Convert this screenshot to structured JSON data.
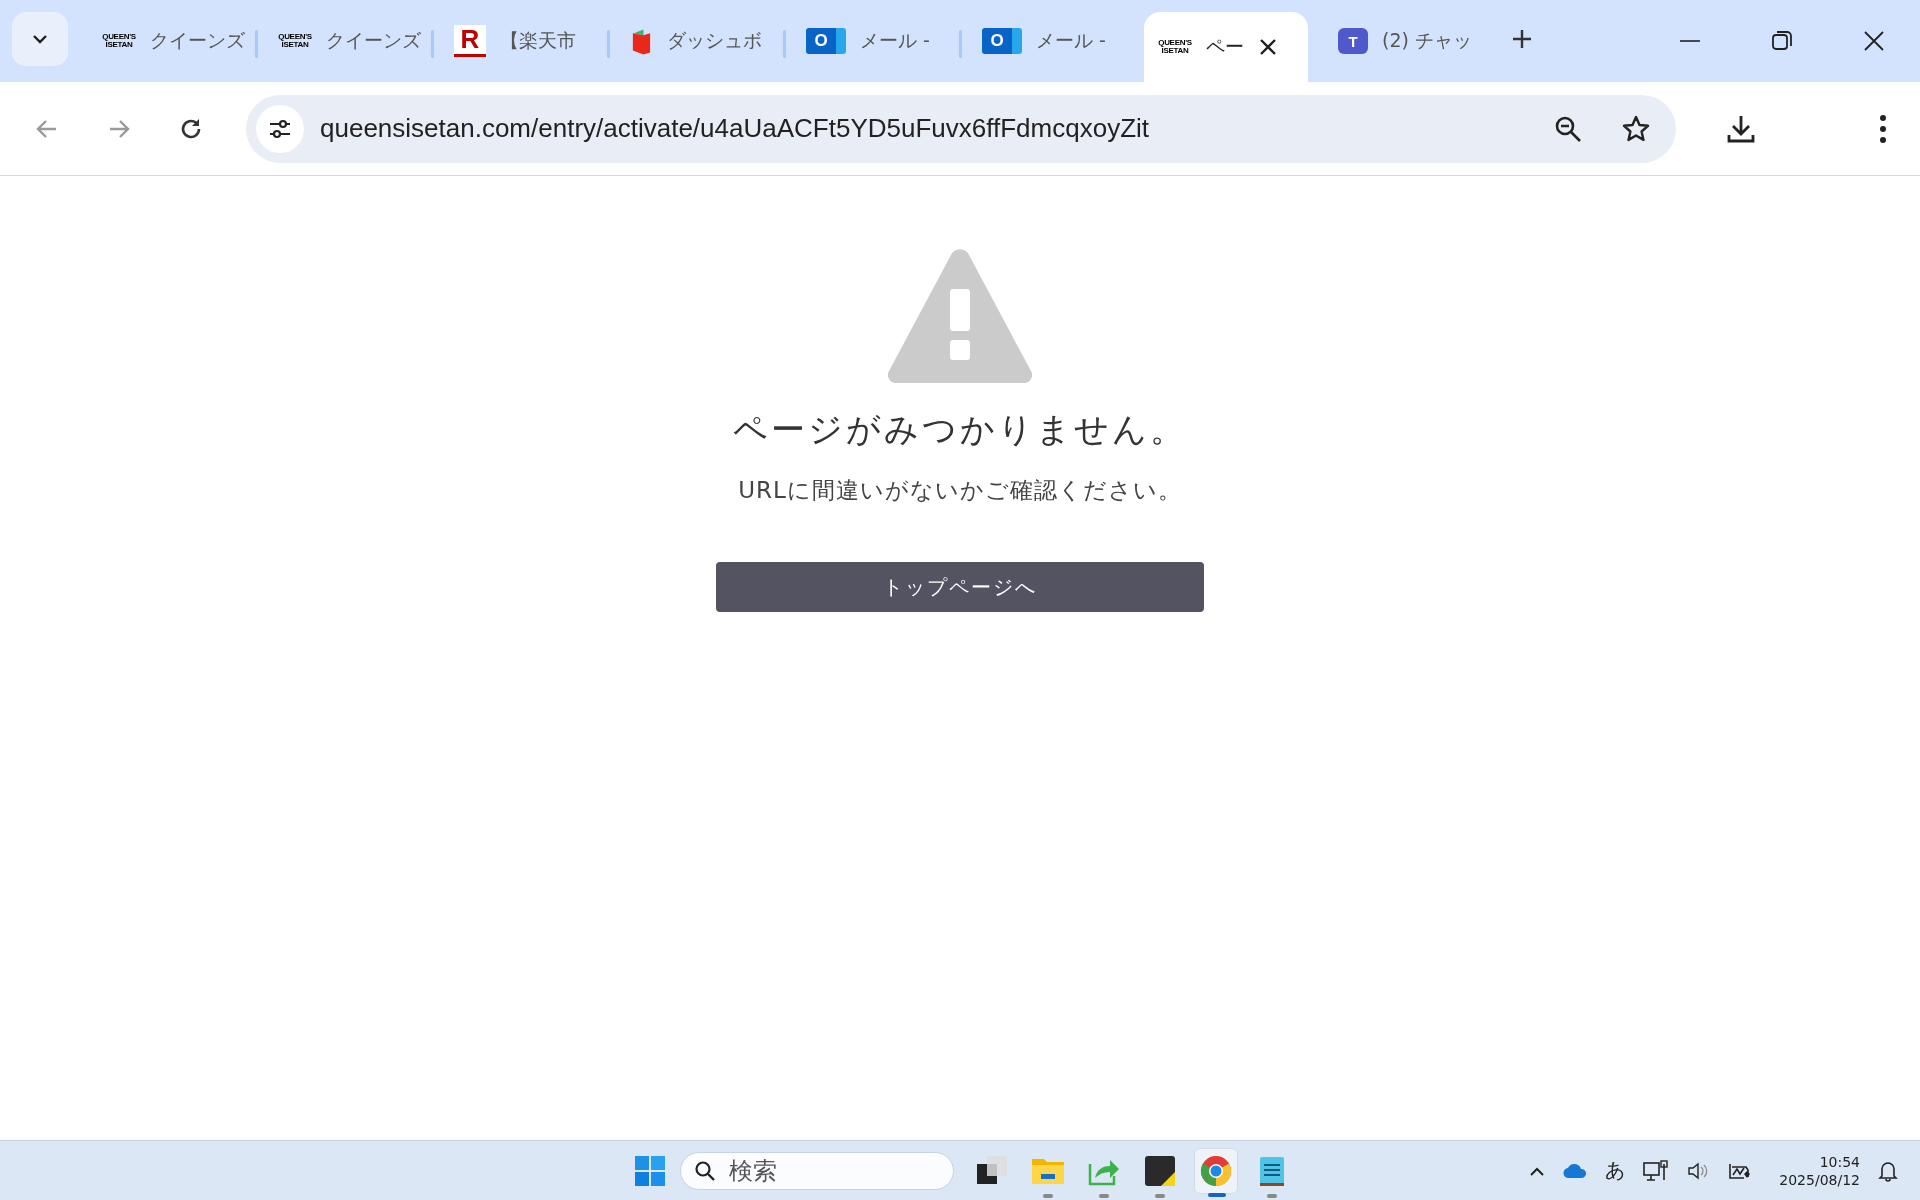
{
  "tabs": [
    {
      "kind": "wordmark",
      "logo": [
        "QUEEN'S",
        "ISETAN"
      ],
      "title": "クイーンズ",
      "selected": false
    },
    {
      "kind": "wordmark",
      "logo": [
        "QUEEN'S",
        "ISETAN"
      ],
      "title": "クイーンズ",
      "selected": false
    },
    {
      "kind": "rakuten",
      "logo": [
        "R"
      ],
      "title": "【楽天市",
      "selected": false
    },
    {
      "kind": "book",
      "title": "ダッシュボ",
      "selected": false
    },
    {
      "kind": "outlook",
      "logo": [
        "O"
      ],
      "title": "メール -",
      "selected": false
    },
    {
      "kind": "outlook",
      "logo": [
        "O"
      ],
      "title": "メール -",
      "selected": false
    },
    {
      "kind": "wordmark",
      "logo": [
        "QUEEN'S",
        "ISETAN"
      ],
      "title": "ペー",
      "selected": true
    },
    {
      "kind": "teams",
      "logo": [
        "T"
      ],
      "title": "(2) チャッ",
      "selected": false
    }
  ],
  "address_bar": {
    "url": "queensisetan.com/entry/activate/u4aUaACFt5YD5uFuvx6ffFdmcqxoyZit"
  },
  "page": {
    "title": "ページがみつかりません。",
    "message": "URLに間違いがないかご確認ください。",
    "button": "トップページへ"
  },
  "taskbar": {
    "search": {
      "placeholder": "検索"
    },
    "apps": [
      {
        "kind": "taskview",
        "running": false,
        "selected": false
      },
      {
        "kind": "folder",
        "running": true,
        "selected": false
      },
      {
        "kind": "share",
        "running": true,
        "selected": false
      },
      {
        "kind": "sticky",
        "running": true,
        "selected": false
      },
      {
        "kind": "chrome",
        "running": true,
        "selected": true
      },
      {
        "kind": "notepad",
        "running": true,
        "selected": false
      }
    ],
    "ime": "あ",
    "time": "10:54",
    "date": "2025/08/12"
  }
}
